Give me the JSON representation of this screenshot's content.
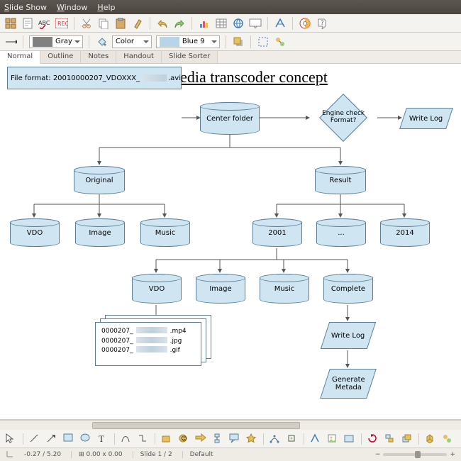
{
  "menu": {
    "items": [
      "Slide Show",
      "Window",
      "Help"
    ]
  },
  "toolbar1": {
    "color_label": "Color",
    "gray_label": "Gray",
    "blue_label": "Blue 9",
    "swatch_gray": "#808080",
    "swatch_blue": "#b8d4e8"
  },
  "tabs": [
    "Normal",
    "Outline",
    "Notes",
    "Handout",
    "Slide Sorter"
  ],
  "slide": {
    "title": "Multimedia transcoder concept",
    "file_format_prefix": "File format: 20010000207_VDOXXX_",
    "file_format_suffix": ".avi",
    "center_folder": "Center folder",
    "engine_check": "Engine check\nFormat?",
    "write_log_top": "Write Log",
    "original": "Original",
    "result": "Result",
    "orig_children": [
      "VDO",
      "Image",
      "Music"
    ],
    "result_children": [
      "2001",
      "...",
      "2014"
    ],
    "year_children": [
      "VDO",
      "Image",
      "Music",
      "Complete"
    ],
    "write_log_bottom": "Write Log",
    "generate_metadata": "Generate\nMetada",
    "file_rows": [
      {
        "prefix": "0000207_",
        "ext": ".mp4"
      },
      {
        "prefix": "0000207_",
        "ext": ".jpg"
      },
      {
        "prefix": "0000207_",
        "ext": ".gif"
      }
    ]
  },
  "status": {
    "coord": "-0.27 / 5.20",
    "size": "0.00 x 0.00",
    "slide_info": "Slide 1 / 2",
    "layout": "Default"
  }
}
